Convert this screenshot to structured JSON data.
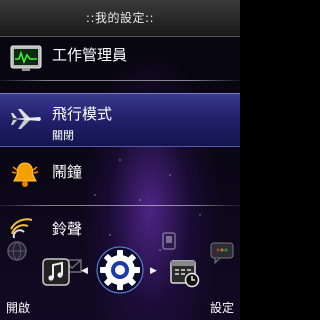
{
  "header": {
    "title": "::我的設定::"
  },
  "menu": {
    "items": [
      {
        "label": "工作管理員",
        "icon": "task-manager-monitor-icon"
      },
      {
        "label": "飛行模式",
        "status": "關閉",
        "icon": "airplane-icon"
      },
      {
        "label": "鬧鐘",
        "icon": "alarm-bell-icon"
      },
      {
        "label": "鈴聲",
        "icon": "ringtone-signal-icon"
      }
    ]
  },
  "dock": {
    "icons": [
      "globe-icon",
      "mail-icon",
      "music-icon",
      "settings-gear-icon",
      "calendar-clock-icon",
      "phone-icon",
      "chat-icon"
    ],
    "selected": "settings-gear-icon"
  },
  "softkeys": {
    "left": "開啟",
    "right": "設定"
  },
  "colors": {
    "highlight": "#20206a",
    "background": "#0a0716",
    "title_bar": "#2a2a2a"
  }
}
